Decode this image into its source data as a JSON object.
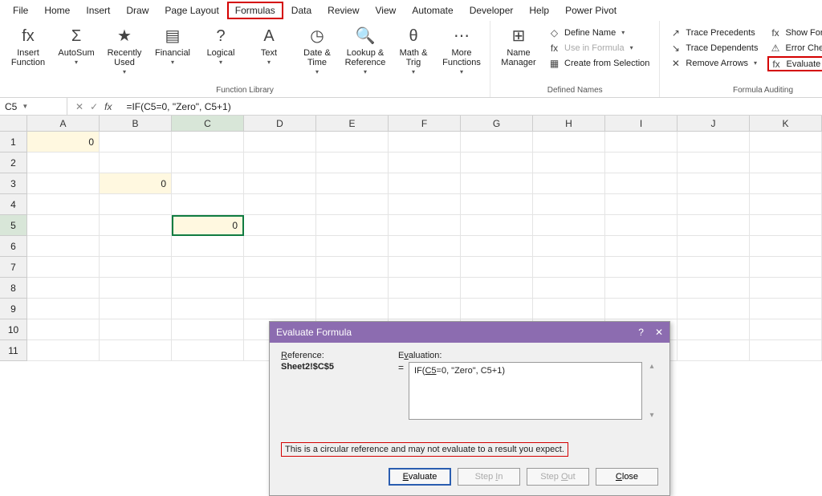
{
  "tabs": [
    "File",
    "Home",
    "Insert",
    "Draw",
    "Page Layout",
    "Formulas",
    "Data",
    "Review",
    "View",
    "Automate",
    "Developer",
    "Help",
    "Power Pivot"
  ],
  "active_tab_index": 5,
  "ribbon": {
    "function_library": {
      "label": "Function Library",
      "items": [
        {
          "label": "Insert\nFunction",
          "icon": "fx"
        },
        {
          "label": "AutoSum",
          "icon": "Σ",
          "drop": true
        },
        {
          "label": "Recently\nUsed",
          "icon": "★",
          "drop": true
        },
        {
          "label": "Financial",
          "icon": "▤",
          "drop": true
        },
        {
          "label": "Logical",
          "icon": "?",
          "drop": true
        },
        {
          "label": "Text",
          "icon": "A",
          "drop": true
        },
        {
          "label": "Date &\nTime",
          "icon": "◷",
          "drop": true
        },
        {
          "label": "Lookup &\nReference",
          "icon": "🔍",
          "drop": true
        },
        {
          "label": "Math &\nTrig",
          "icon": "θ",
          "drop": true
        },
        {
          "label": "More\nFunctions",
          "icon": "⋯",
          "drop": true
        }
      ]
    },
    "defined_names": {
      "label": "Defined Names",
      "big": {
        "label": "Name\nManager",
        "icon": "⊞"
      },
      "items": [
        {
          "label": "Define Name",
          "icon": "◇",
          "drop": true
        },
        {
          "label": "Use in Formula",
          "icon": "fx",
          "drop": true,
          "disabled": true
        },
        {
          "label": "Create from Selection",
          "icon": "▦"
        }
      ]
    },
    "formula_auditing": {
      "label": "Formula Auditing",
      "left": [
        {
          "label": "Trace Precedents",
          "icon": "↗"
        },
        {
          "label": "Trace Dependents",
          "icon": "↘"
        },
        {
          "label": "Remove Arrows",
          "icon": "✕",
          "drop": true
        }
      ],
      "right": [
        {
          "label": "Show Formulas",
          "icon": "fx"
        },
        {
          "label": "Error Checking",
          "icon": "⚠",
          "drop": true
        },
        {
          "label": "Evaluate Formula",
          "icon": "fx",
          "highlighted": true
        }
      ]
    }
  },
  "formula_bar": {
    "name_box": "C5",
    "formula": "=IF(C5=0, \"Zero\", C5+1)"
  },
  "grid": {
    "columns": [
      "A",
      "B",
      "C",
      "D",
      "E",
      "F",
      "G",
      "H",
      "I",
      "J",
      "K"
    ],
    "active_col": "C",
    "rows": 11,
    "active_row": 5,
    "cells": {
      "A1": {
        "value": "0",
        "yellow": true
      },
      "B3": {
        "value": "0",
        "yellow": true
      },
      "C5": {
        "value": "0",
        "yellow": true,
        "selected": true,
        "redbox": true
      }
    }
  },
  "dialog": {
    "title": "Evaluate Formula",
    "ref_label": "Reference:",
    "ref_value": "Sheet2!$C$5",
    "eval_label": "Evaluation:",
    "eval_expr_pre": "IF(",
    "eval_expr_ul": "C5",
    "eval_expr_post": "=0, \"Zero\", C5+1)",
    "warning": "This is a circular reference and may not evaluate to a result you expect.",
    "buttons": {
      "evaluate": "Evaluate",
      "stepin": "Step In",
      "stepout": "Step Out",
      "close": "Close"
    }
  }
}
